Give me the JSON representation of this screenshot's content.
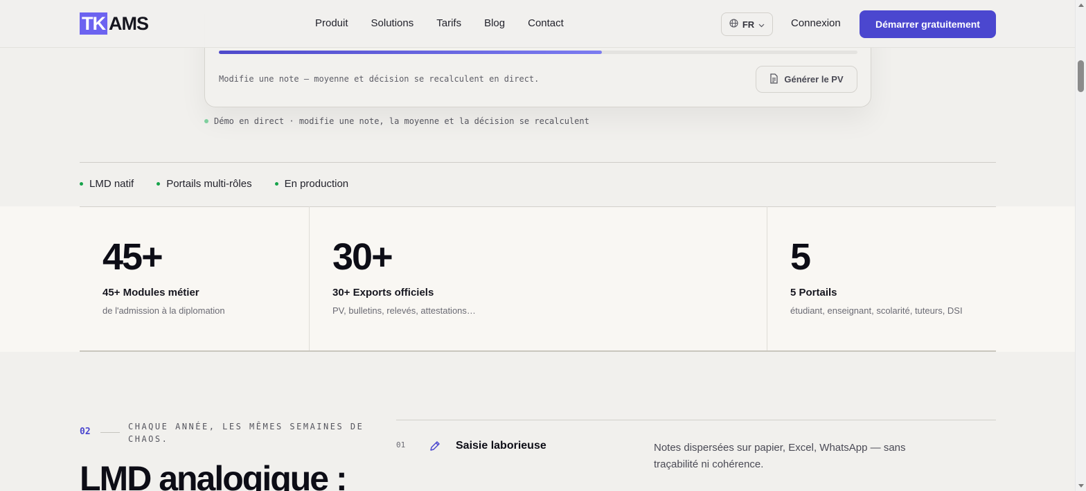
{
  "header": {
    "logo_mark": "TK",
    "logo_text": "AMS",
    "nav": [
      "Produit",
      "Solutions",
      "Tarifs",
      "Blog",
      "Contact"
    ],
    "language": "FR",
    "login": "Connexion",
    "cta": "Démarrer gratuitement"
  },
  "demo": {
    "progress_fraction": 0.6,
    "hint": "Modifie une note — moyenne et décision se recalculent en direct.",
    "pv_button": "Générer le PV",
    "caption": "Démo en direct · modifie une note, la moyenne et la décision se recalculent"
  },
  "tags": [
    "LMD natif",
    "Portails multi-rôles",
    "En production"
  ],
  "stats": [
    {
      "value": "45+",
      "title": "45+ Modules métier",
      "desc": "de l'admission à la diplomation"
    },
    {
      "value": "30+",
      "title": "30+ Exports officiels",
      "desc": "PV, bulletins, relevés, attestations…"
    },
    {
      "value": "5",
      "title": "5 Portails",
      "desc": "étudiant, enseignant, scolarité, tuteurs, DSI"
    }
  ],
  "section": {
    "number": "02",
    "kicker": "CHAQUE ANNÉE, LES MÊMES SEMAINES DE CHAOS.",
    "heading": "LMD analogique :",
    "problems": [
      {
        "index": "01",
        "icon": "pencil-icon",
        "title": "Saisie laborieuse",
        "desc": "Notes dispersées sur papier, Excel, WhatsApp — sans traçabilité ni cohérence."
      }
    ]
  },
  "colors": {
    "accent": "#4b47cf",
    "logo": "#6c63f0",
    "status_dot": "#16a34a"
  }
}
